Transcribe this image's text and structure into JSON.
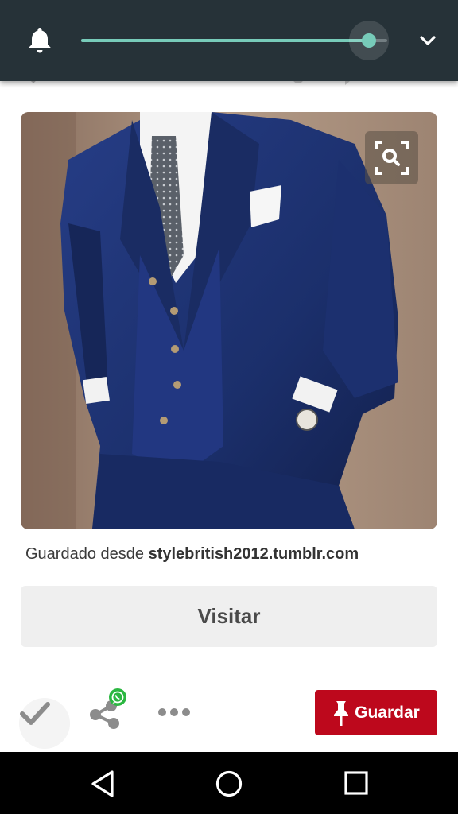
{
  "volume": {
    "level": 0.94
  },
  "pin": {
    "saved_from_prefix": "Guardado desde",
    "saved_from_source": "stylebritish2012.tumblr.com",
    "visit_label": "Visitar",
    "save_label": "Guardar"
  },
  "colors": {
    "overlay_bg": "#263238",
    "accent": "#77cbb9",
    "save_red": "#bd081c"
  },
  "icons": [
    "bell-icon",
    "chevron-down-icon",
    "zoom-lens-icon",
    "check-icon",
    "share-icon",
    "whatsapp-icon",
    "more-icon",
    "pin-icon",
    "nav-back-icon",
    "nav-home-icon",
    "nav-recent-icon"
  ]
}
